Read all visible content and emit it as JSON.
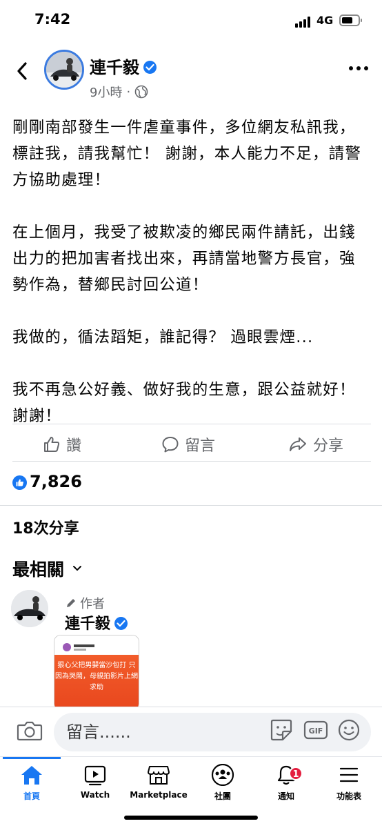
{
  "status_bar": {
    "time": "7:42",
    "network": "4G",
    "battery_level": 0.7
  },
  "post": {
    "author": "連千毅",
    "time_ago": "9小時",
    "meta_separator": "·",
    "privacy_icon": "globe-icon",
    "paragraphs": [
      "剛剛南部發生一件虐童事件，多位網友私訊我，標註我，請我幫忙！ 謝謝，本人能力不足，請警方協助處理！",
      "在上個月，我受了被欺凌的鄉民兩件請託，出錢出力的把加害者找出來，再請當地警方長官，強勢作為，替鄉民討回公道！",
      "我做的，循法蹈矩，誰記得？ 過眼雲煙...",
      "我不再急公好義、做好我的生意，跟公益就好！謝謝！"
    ],
    "actions": {
      "like": "讚",
      "comment": "留言",
      "share": "分享"
    },
    "reaction_count": "7,826",
    "share_count": "18",
    "share_suffix": "次分享"
  },
  "comments": {
    "sort_label": "最相關",
    "first": {
      "author_tag": "作者",
      "name": "連千毅",
      "image_headline": "狠心父把男嬰當沙包打 只因為哭鬧，母親拍影片上網求助"
    }
  },
  "composer": {
    "placeholder": "留言......"
  },
  "nav": {
    "items": [
      {
        "label": "首頁",
        "icon": "home-icon"
      },
      {
        "label": "Watch",
        "icon": "watch-icon"
      },
      {
        "label": "Marketplace",
        "icon": "marketplace-icon"
      },
      {
        "label": "社團",
        "icon": "groups-icon"
      },
      {
        "label": "通知",
        "icon": "bell-icon"
      },
      {
        "label": "功能表",
        "icon": "menu-icon"
      }
    ],
    "notification_badge": "1"
  },
  "colors": {
    "accent": "#1877f2",
    "secondary_text": "#65676b",
    "badge": "#e41e3f"
  }
}
